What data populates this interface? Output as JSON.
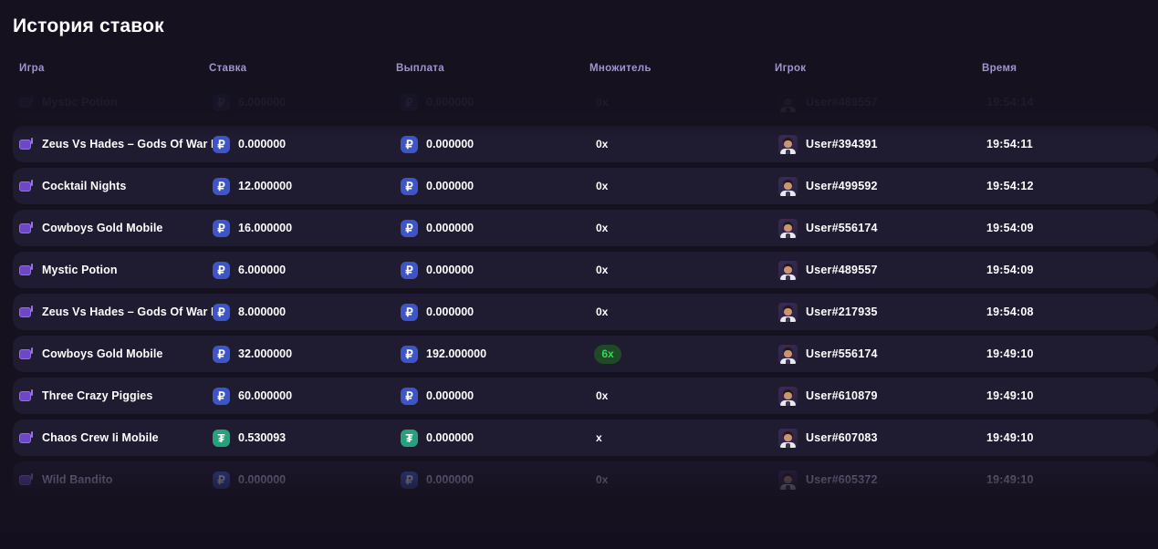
{
  "page": {
    "title": "История ставок",
    "background_color": "#15111f",
    "row_background_color": "#1f1b30",
    "accent_color": "#9b6ef0",
    "header_text_color": "#a294cf"
  },
  "table": {
    "columns": [
      {
        "key": "game",
        "label": "Игра"
      },
      {
        "key": "bet",
        "label": "Ставка"
      },
      {
        "key": "payout",
        "label": "Выплата"
      },
      {
        "key": "multiplier",
        "label": "Множитель"
      },
      {
        "key": "player",
        "label": "Игрок"
      },
      {
        "key": "time",
        "label": "Время"
      }
    ],
    "rows": [
      {
        "game": "Mystic Potion",
        "game_icon": "game-screen-icon",
        "bet_currency": "rub",
        "bet_symbol": "₽",
        "bet": "6.000000",
        "payout_currency": "rub",
        "payout_symbol": "₽",
        "payout": "0.000000",
        "multiplier": "0x",
        "multiplier_highlight": false,
        "player": "User#489557",
        "time": "19:54:14",
        "faded": true
      },
      {
        "game": "Zeus Vs Hades – Gods Of War M",
        "game_icon": "game-screen-icon",
        "bet_currency": "rub",
        "bet_symbol": "₽",
        "bet": "0.000000",
        "payout_currency": "rub",
        "payout_symbol": "₽",
        "payout": "0.000000",
        "multiplier": "0x",
        "multiplier_highlight": false,
        "player": "User#394391",
        "time": "19:54:11",
        "faded": false
      },
      {
        "game": "Cocktail Nights",
        "game_icon": "game-screen-icon",
        "bet_currency": "rub",
        "bet_symbol": "₽",
        "bet": "12.000000",
        "payout_currency": "rub",
        "payout_symbol": "₽",
        "payout": "0.000000",
        "multiplier": "0x",
        "multiplier_highlight": false,
        "player": "User#499592",
        "time": "19:54:12",
        "faded": false
      },
      {
        "game": "Cowboys Gold Mobile",
        "game_icon": "game-screen-icon",
        "bet_currency": "rub",
        "bet_symbol": "₽",
        "bet": "16.000000",
        "payout_currency": "rub",
        "payout_symbol": "₽",
        "payout": "0.000000",
        "multiplier": "0x",
        "multiplier_highlight": false,
        "player": "User#556174",
        "time": "19:54:09",
        "faded": false
      },
      {
        "game": "Mystic Potion",
        "game_icon": "game-screen-icon",
        "bet_currency": "rub",
        "bet_symbol": "₽",
        "bet": "6.000000",
        "payout_currency": "rub",
        "payout_symbol": "₽",
        "payout": "0.000000",
        "multiplier": "0x",
        "multiplier_highlight": false,
        "player": "User#489557",
        "time": "19:54:09",
        "faded": false
      },
      {
        "game": "Zeus Vs Hades – Gods Of War M",
        "game_icon": "game-screen-icon",
        "bet_currency": "rub",
        "bet_symbol": "₽",
        "bet": "8.000000",
        "payout_currency": "rub",
        "payout_symbol": "₽",
        "payout": "0.000000",
        "multiplier": "0x",
        "multiplier_highlight": false,
        "player": "User#217935",
        "time": "19:54:08",
        "faded": false
      },
      {
        "game": "Cowboys Gold Mobile",
        "game_icon": "game-screen-icon",
        "bet_currency": "rub",
        "bet_symbol": "₽",
        "bet": "32.000000",
        "payout_currency": "rub",
        "payout_symbol": "₽",
        "payout": "192.000000",
        "multiplier": "6x",
        "multiplier_highlight": true,
        "player": "User#556174",
        "time": "19:49:10",
        "faded": false
      },
      {
        "game": "Three Crazy Piggies",
        "game_icon": "game-screen-icon",
        "bet_currency": "rub",
        "bet_symbol": "₽",
        "bet": "60.000000",
        "payout_currency": "rub",
        "payout_symbol": "₽",
        "payout": "0.000000",
        "multiplier": "0x",
        "multiplier_highlight": false,
        "player": "User#610879",
        "time": "19:49:10",
        "faded": false
      },
      {
        "game": "Chaos Crew Ii Mobile",
        "game_icon": "game-screen-icon",
        "bet_currency": "usdt",
        "bet_symbol": "₮",
        "bet": "0.530093",
        "payout_currency": "usdt",
        "payout_symbol": "₮",
        "payout": "0.000000",
        "multiplier": "x",
        "multiplier_highlight": false,
        "player": "User#607083",
        "time": "19:49:10",
        "faded": false
      },
      {
        "game": "Wild Bandito",
        "game_icon": "game-screen-icon",
        "bet_currency": "rub",
        "bet_symbol": "₽",
        "bet": "0.000000",
        "payout_currency": "rub",
        "payout_symbol": "₽",
        "payout": "0.000000",
        "multiplier": "0x",
        "multiplier_highlight": false,
        "player": "User#605372",
        "time": "19:49:10",
        "faded": true
      }
    ]
  }
}
